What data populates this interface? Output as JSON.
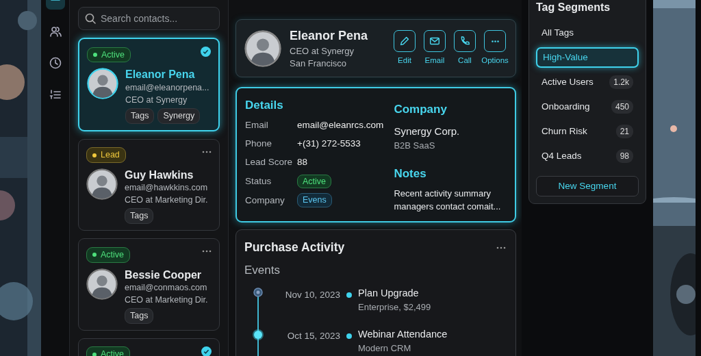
{
  "nav_rail": [
    {
      "kind": "menu",
      "selected": true
    },
    {
      "kind": "contacts",
      "selected": false
    },
    {
      "kind": "history",
      "selected": false
    },
    {
      "kind": "list",
      "selected": false
    }
  ],
  "search": {
    "placeholder": "Search contacts..."
  },
  "contacts": [
    {
      "status": "Active",
      "kind": "active",
      "name": "Eleanor Pena",
      "email": "email@eleanorpena...",
      "title": "CEO at Synergy",
      "tags": [
        "Tags",
        "Synergy"
      ],
      "selected": true,
      "checked": true
    },
    {
      "status": "Lead",
      "kind": "lead",
      "name": "Guy Hawkins",
      "email": "email@hawkkins.com",
      "title": "CEO at Marketing Dir.",
      "tags": [
        "Tags"
      ],
      "selected": false,
      "checked": false
    },
    {
      "status": "Active",
      "kind": "active",
      "name": "Bessie Cooper",
      "email": "email@conmaos.com",
      "title": "CEO at Marketing Dir.",
      "tags": [
        "Tags"
      ],
      "selected": false,
      "checked": false
    },
    {
      "status": "Active",
      "kind": "active",
      "selected": false,
      "checked": true
    }
  ],
  "profile": {
    "name": "Eleanor Pena",
    "title": "CEO at Synergy",
    "location": "San Francisco",
    "actions": [
      {
        "kind": "edit",
        "label": "Edit"
      },
      {
        "kind": "email",
        "label": "Email"
      },
      {
        "kind": "call",
        "label": "Call"
      },
      {
        "kind": "options",
        "label": "Options"
      }
    ]
  },
  "details": {
    "heading": "Details",
    "fields": [
      {
        "label": "Email",
        "value": "email@eleanrcs.com",
        "kind": "text"
      },
      {
        "label": "Phone",
        "value": "+(31) 272-5533",
        "kind": "text"
      },
      {
        "label": "Lead Score",
        "value": "88",
        "kind": "text"
      },
      {
        "label": "Status",
        "value": "Active",
        "kind": "status"
      },
      {
        "label": "Company",
        "value": "Evens",
        "kind": "tag"
      }
    ]
  },
  "company": {
    "heading": "Company",
    "name": "Synergy Corp.",
    "type": "B2B SaaS"
  },
  "notes": {
    "heading": "Notes",
    "text": "Recent activity summary managers contact comait..."
  },
  "activity": {
    "title": "Purchase Activity",
    "subtitle": "Events",
    "events": [
      {
        "date": "Nov 10, 2023",
        "title": "Plan Upgrade",
        "detail": "Enterprise, $2,499",
        "highlighted": false
      },
      {
        "date": "Oct 15, 2023",
        "title": "Webinar Attendance",
        "detail": "Modern CRM",
        "highlighted": true
      }
    ]
  },
  "segments": {
    "title": "Tag Segments",
    "items": [
      {
        "label": "All Tags",
        "selected": false
      },
      {
        "label": "High-Value",
        "selected": true
      },
      {
        "label": "Active Users",
        "count": "1.2k",
        "selected": false
      },
      {
        "label": "Onboarding",
        "count": "450",
        "selected": false
      },
      {
        "label": "Churn Risk",
        "count": "21",
        "selected": false
      },
      {
        "label": "Q4 Leads",
        "count": "98",
        "selected": false
      }
    ],
    "button": "New Segment"
  }
}
